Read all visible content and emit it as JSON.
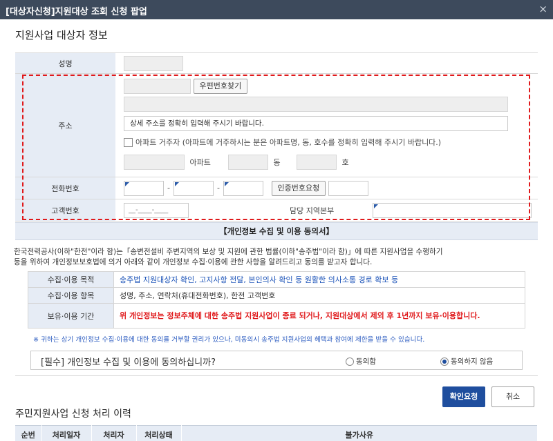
{
  "window": {
    "title": "[대상자신청]지원대상 조회 신청 팝업",
    "close_glyph": "×"
  },
  "applicant": {
    "section_title": "지원사업 대상자 정보",
    "name_label": "성명",
    "address_label": "주소",
    "zip_button": "우편번호찾기",
    "detail_placeholder": "상세 주소를 정확히 입력해 주시기 바랍니다.",
    "apartment_checkbox_label": "아파트 거주자 (아파트에 거주하시는 분은 아파트명, 동, 호수를 정확히 입력해 주시기 바랍니다.)",
    "apartment_unit": "아파트",
    "dong_unit": "동",
    "ho_unit": "호",
    "phone_label": "전화번호",
    "phone_sep": "-",
    "verify_button": "인증번호요청",
    "customer_no_label": "고객번호",
    "customer_no_placeholder": "__-____-____",
    "region_label": "담당 지역본부"
  },
  "consent": {
    "heading": "【개인정보 수집 및 이용 동의서】",
    "intro_line1": "한국전력공사(이하\"한전\"이라 함)는「송변전설비 주변지역의 보상 및 지원에 관한 법률(이하\"송주법\"이라 함)」에 따른 지원사업을 수행하기",
    "intro_line2": "등을 위하여 개인정보보호법에 의거 아래와 같이 개인정보 수집·이용에 관한 사항을 알려드리고 동의를 받고자 합니다.",
    "rows": [
      {
        "label": "수집·이용 목적",
        "value": "송주법 지원대상자 확인, 고지사항 전달, 본인의사 확인 등 원활한 의사소통 경로 확보 등"
      },
      {
        "label": "수집·이용 항목",
        "value": "성명, 주소, 연락처(휴대전화번호), 한전 고객번호"
      },
      {
        "label": "보유·이용 기간",
        "value": "위 개인정보는 정보주체에 대한 송주법 지원사업이 종료 되거나, 지원대상에서 제외 후 1년까지 보유·이용합니다."
      }
    ],
    "note": "※ 귀하는 상기 개인정보 수집·이용에 대한 동의를 거부할 권리가 있으나, 미동의시 송주법 지원사업의 혜택과 참여에 제한을 받을 수 있습니다.",
    "question": "[필수] 개인정보 수집 및 이용에 동의하십니까?",
    "agree_label": "동의함",
    "disagree_label": "동의하지 않음",
    "selected": "disagree"
  },
  "actions": {
    "confirm": "확인요청",
    "cancel": "취소"
  },
  "history": {
    "title": "주민지원사업 신청 처리 이력",
    "columns": [
      "순번",
      "처리일자",
      "처리자",
      "처리상태",
      "불가사유"
    ]
  },
  "colors": {
    "titlebar": "#3d4a5c",
    "label_bg": "#e6ecf5",
    "primary": "#1f4e9e",
    "highlight_border": "#e0191b",
    "text_blue": "#1a52b8",
    "text_red": "#e0191b"
  }
}
